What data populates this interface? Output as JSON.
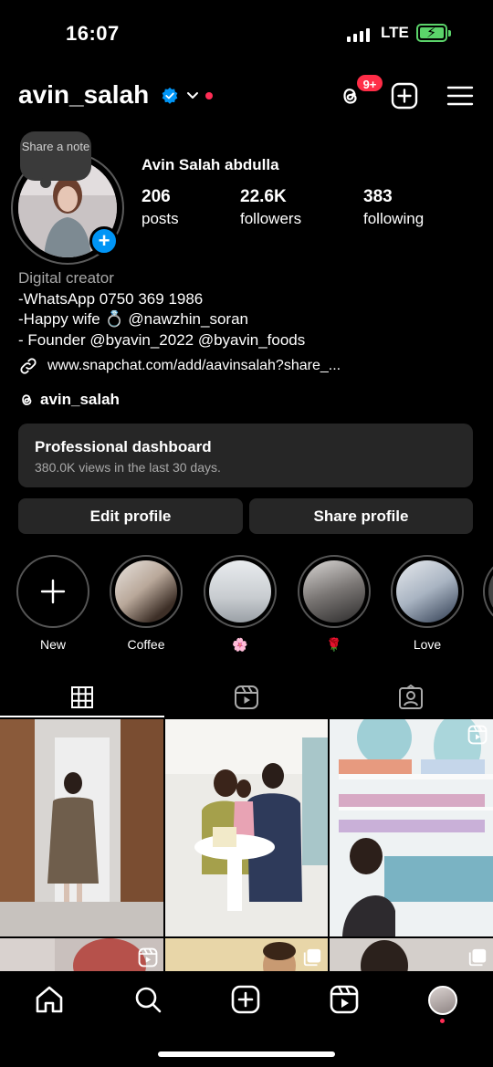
{
  "status_bar": {
    "time": "16:07",
    "network": "LTE"
  },
  "header": {
    "username": "avin_salah",
    "threads_badge": "9+"
  },
  "profile": {
    "note_label": "Share a note",
    "full_name": "Avin Salah abdulla",
    "stats": [
      {
        "value": "206",
        "label": "posts"
      },
      {
        "value": "22.6K",
        "label": "followers"
      },
      {
        "value": "383",
        "label": "following"
      }
    ],
    "bio": {
      "category": "Digital creator",
      "lines": [
        "-WhatsApp 0750 369 1986",
        "-Happy wife 💍 @nawzhin_soran",
        "- Founder  @byavin_2022 @byavin_foods"
      ],
      "link": "www.snapchat.com/add/aavinsalah?share_...",
      "threads_handle": "avin_salah"
    }
  },
  "dashboard": {
    "title": "Professional dashboard",
    "subtitle": "380.0K views in the last 30 days."
  },
  "buttons": {
    "edit": "Edit profile",
    "share": "Share profile"
  },
  "highlights": [
    {
      "label": "New"
    },
    {
      "label": "Coffee"
    },
    {
      "label": "🌸"
    },
    {
      "label": "🌹"
    },
    {
      "label": "Love"
    }
  ],
  "colors": {
    "accent_blue": "#0095f6",
    "badge_red": "#ff2d47",
    "surface": "#262626",
    "muted": "#a8a8a8"
  },
  "icons": [
    "verified-icon",
    "threads-icon",
    "add-post-icon",
    "menu-icon",
    "link-icon",
    "grid-icon",
    "reels-icon",
    "tagged-icon",
    "home-icon",
    "search-icon",
    "create-icon"
  ]
}
